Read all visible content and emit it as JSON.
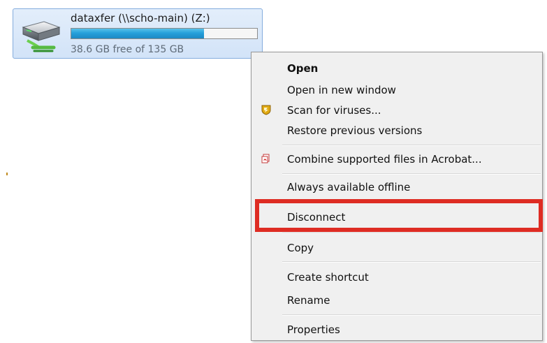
{
  "drive": {
    "name": "dataxfer (\\\\scho-main) (Z:)",
    "size_text": "38.6 GB free of 135 GB",
    "used_fraction": 0.714
  },
  "context_menu": {
    "items": [
      {
        "label": "Open",
        "bold": true
      },
      {
        "label": "Open in new window"
      },
      {
        "label": "Scan for viruses...",
        "icon": "antivirus-shield-icon"
      },
      {
        "label": "Restore previous versions"
      },
      {
        "label": "Combine supported files in Acrobat...",
        "icon": "acrobat-combine-icon"
      },
      {
        "label": "Always available offline"
      },
      {
        "label": "Disconnect",
        "highlighted": true
      },
      {
        "label": "Copy"
      },
      {
        "label": "Create shortcut"
      },
      {
        "label": "Rename"
      },
      {
        "label": "Properties"
      }
    ]
  },
  "colors": {
    "highlight": "#de2c23",
    "drive_bar_fill": "#26a0da",
    "tile_border": "#84acdd"
  }
}
